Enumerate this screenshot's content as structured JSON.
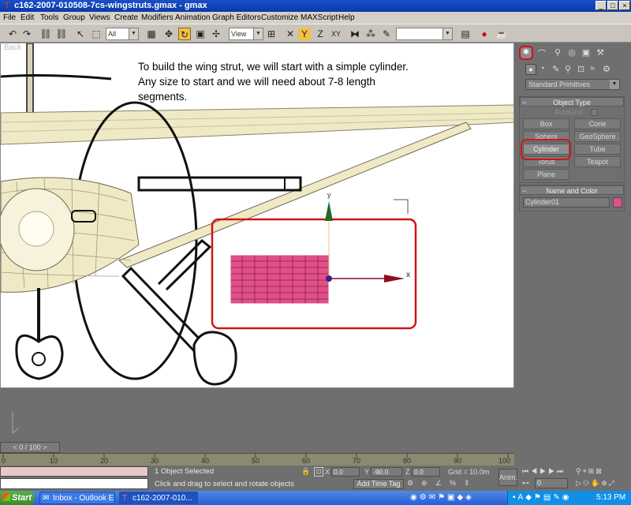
{
  "window": {
    "title": "c162-2007-010508-7cs-wingstruts.gmax - gmax",
    "minimize_glyph": "_",
    "maximize_glyph": "□",
    "close_glyph": "×",
    "app_icon": "gmax-tee-icon"
  },
  "menu": [
    "File",
    "Edit",
    "Tools",
    "Group",
    "Views",
    "Create",
    "Modifiers",
    "Animation",
    "Graph Editors",
    "Customize",
    "MAXScript",
    "Help"
  ],
  "toolbar": {
    "selection_filter": "All",
    "ref_coord": "View",
    "named_selection": ""
  },
  "viewport": {
    "label": "Back",
    "instruction": "To build the wing strut, we will start with a simple cylinder.  Any size to start and we will need about 7-8 length segments.",
    "axis_x": "x",
    "axis_y": "y"
  },
  "command_panel": {
    "category": "Standard Primitives",
    "object_type_title": "Object Type",
    "autogrid_label": "AutoGrid",
    "buttons": [
      "Box",
      "Cone",
      "Sphere",
      "GeoSphere",
      "Cylinder",
      "Tube",
      "Torus",
      "Teapot",
      "Plane"
    ],
    "name_color_title": "Name and Color",
    "object_name": "Cylinder01",
    "object_color": "#e0508a"
  },
  "timeline": {
    "frame_display": "0 / 100",
    "ticks": [
      "0",
      "10",
      "20",
      "30",
      "40",
      "50",
      "60",
      "70",
      "80",
      "90",
      "100"
    ]
  },
  "status": {
    "selection": "1 Object Selected",
    "prompt": "Click and drag to select and rotate objects",
    "x_label": "X",
    "x_value": "0.0",
    "y_label": "Y",
    "y_value": "-90.0",
    "z_label": "Z",
    "z_value": "0.0",
    "grid": "Grid = 10.0m",
    "add_time_tag": "Add Time Tag",
    "anim_label": "Anim.",
    "frame_field": "0"
  },
  "taskbar": {
    "start": "Start",
    "tasks": [
      "Inbox - Outlook E...",
      "c162-2007-010..."
    ],
    "clock": "5:13 PM"
  },
  "colors": {
    "highlight_red": "#d0141a",
    "cylinder_pink": "#e0508a",
    "wing_cream": "#efe9c6"
  }
}
